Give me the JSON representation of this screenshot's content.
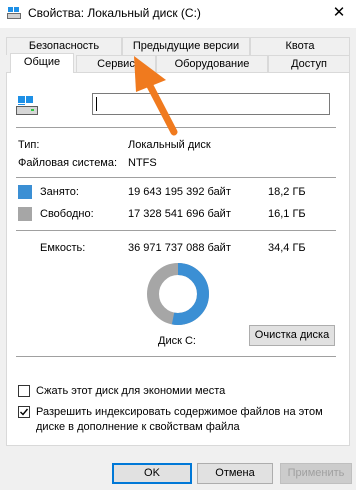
{
  "window": {
    "title": "Свойства: Локальный диск (C:)",
    "close_glyph": "✕"
  },
  "tabs_row1": [
    "Безопасность",
    "Предыдущие версии",
    "Квота"
  ],
  "tabs_row2": [
    "Общие",
    "Сервис",
    "Оборудование",
    "Доступ"
  ],
  "active_tab": "Общие",
  "general": {
    "name_value": "",
    "type_label": "Тип:",
    "type_value": "Локальный диск",
    "fs_label": "Файловая система:",
    "fs_value": "NTFS",
    "used": {
      "label": "Занято:",
      "bytes": "19 643 195 392 байт",
      "size": "18,2 ГБ",
      "color": "#3b8fd4"
    },
    "free": {
      "label": "Свободно:",
      "bytes": "17 328 541 696 байт",
      "size": "16,1 ГБ",
      "color": "#a6a6a6"
    },
    "capacity": {
      "label": "Емкость:",
      "bytes": "36 971 737 088 байт",
      "size": "34,4 ГБ"
    },
    "disk_label": "Диск C:",
    "cleanup_button": "Очистка диска",
    "used_fraction": 0.531,
    "compress_label": "Сжать этот диск для экономии места",
    "compress_checked": false,
    "index_label_line1": "Разрешить индексировать содержимое файлов на этом",
    "index_label_line2": "диске в дополнение к свойствам файла",
    "index_checked": true
  },
  "footer": {
    "ok": "OK",
    "cancel": "Отмена",
    "apply": "Применить"
  },
  "annotation": {
    "color": "#f07a1e"
  }
}
